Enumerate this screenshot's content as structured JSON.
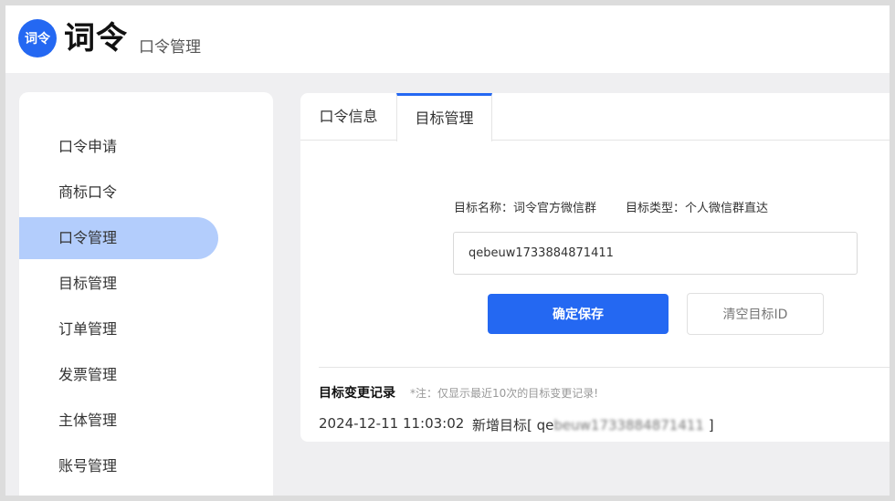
{
  "header": {
    "logo_text": "词令",
    "brand": "词令",
    "subtitle": "口令管理"
  },
  "sidebar": {
    "items": [
      {
        "label": "口令申请"
      },
      {
        "label": "商标口令"
      },
      {
        "label": "口令管理",
        "active": true
      },
      {
        "label": "目标管理"
      },
      {
        "label": "订单管理"
      },
      {
        "label": "发票管理"
      },
      {
        "label": "主体管理"
      },
      {
        "label": "账号管理"
      }
    ]
  },
  "tabs": [
    {
      "label": "口令信息"
    },
    {
      "label": "目标管理",
      "active": true
    }
  ],
  "target": {
    "name_text": "目标名称：词令官方微信群",
    "type_text": "目标类型：个人微信群直达",
    "input_value": "qebeuw1733884871411"
  },
  "buttons": {
    "save": "确定保存",
    "clear": "清空目标ID"
  },
  "records": {
    "title": "目标变更记录",
    "note": "*注：仅显示最近10次的目标变更记录!",
    "items": [
      {
        "time": "2024-12-11 11:03:02",
        "prefix": "新增目标[ qe",
        "value": "beuw1733884871411",
        "suffix": " ]"
      }
    ]
  },
  "colors": {
    "accent": "#2468f2",
    "active_nav": "#b3cdfc",
    "background": "#efeff1"
  }
}
